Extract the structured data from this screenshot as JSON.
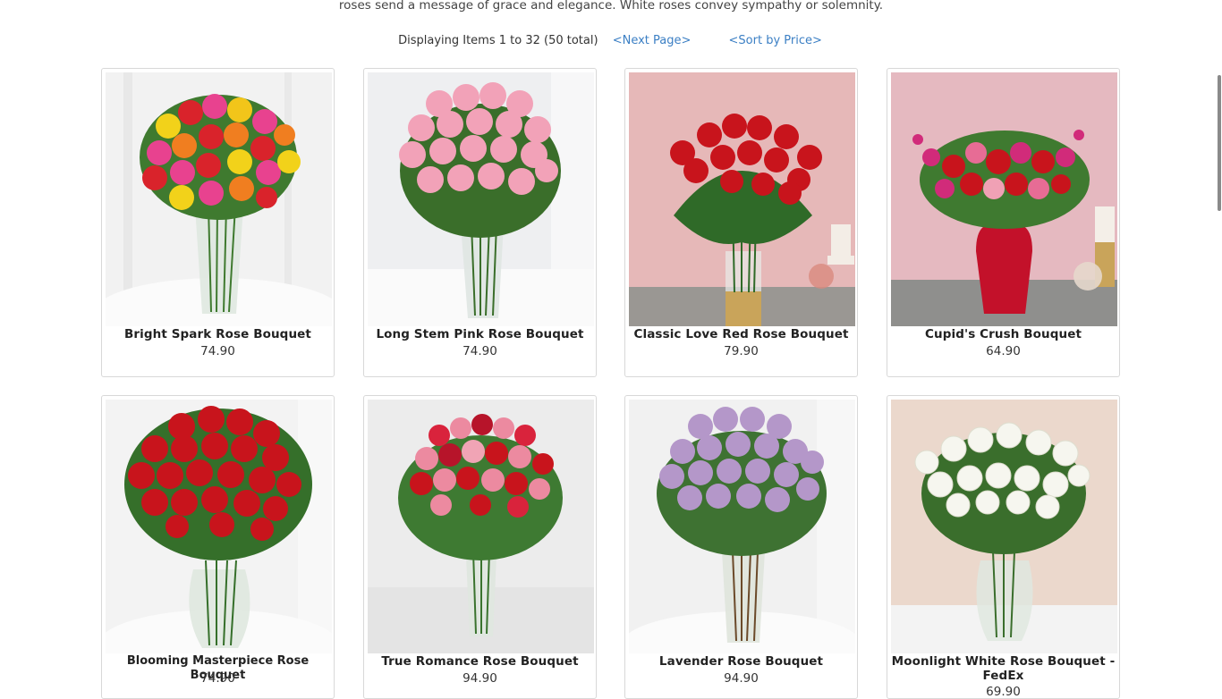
{
  "intro": {
    "text": "roses send a message of grace and elegance. White roses convey sympathy or solemnity."
  },
  "pager": {
    "count": "Displaying Items 1 to 32 (50 total)",
    "next": "<Next Page>",
    "sort": "<Sort by Price>"
  },
  "products": [
    {
      "name": "Bright Spark Rose Bouquet",
      "price": "74.90"
    },
    {
      "name": "Long Stem Pink Rose Bouquet",
      "price": "74.90"
    },
    {
      "name": "Classic Love Red Rose Bouquet",
      "price": "79.90"
    },
    {
      "name": "Cupid's Crush Bouquet",
      "price": "64.90"
    },
    {
      "name": "Blooming Masterpiece Rose Bouquet",
      "price": "74.90"
    },
    {
      "name": "True Romance Rose Bouquet",
      "price": "94.90"
    },
    {
      "name": "Lavender Rose Bouquet",
      "price": "94.90"
    },
    {
      "name": "Moonlight White Rose Bouquet - FedEx",
      "price": "69.90"
    }
  ],
  "colors": {
    "link": "#3b7fc4",
    "card_border": "#d8d8d8"
  }
}
